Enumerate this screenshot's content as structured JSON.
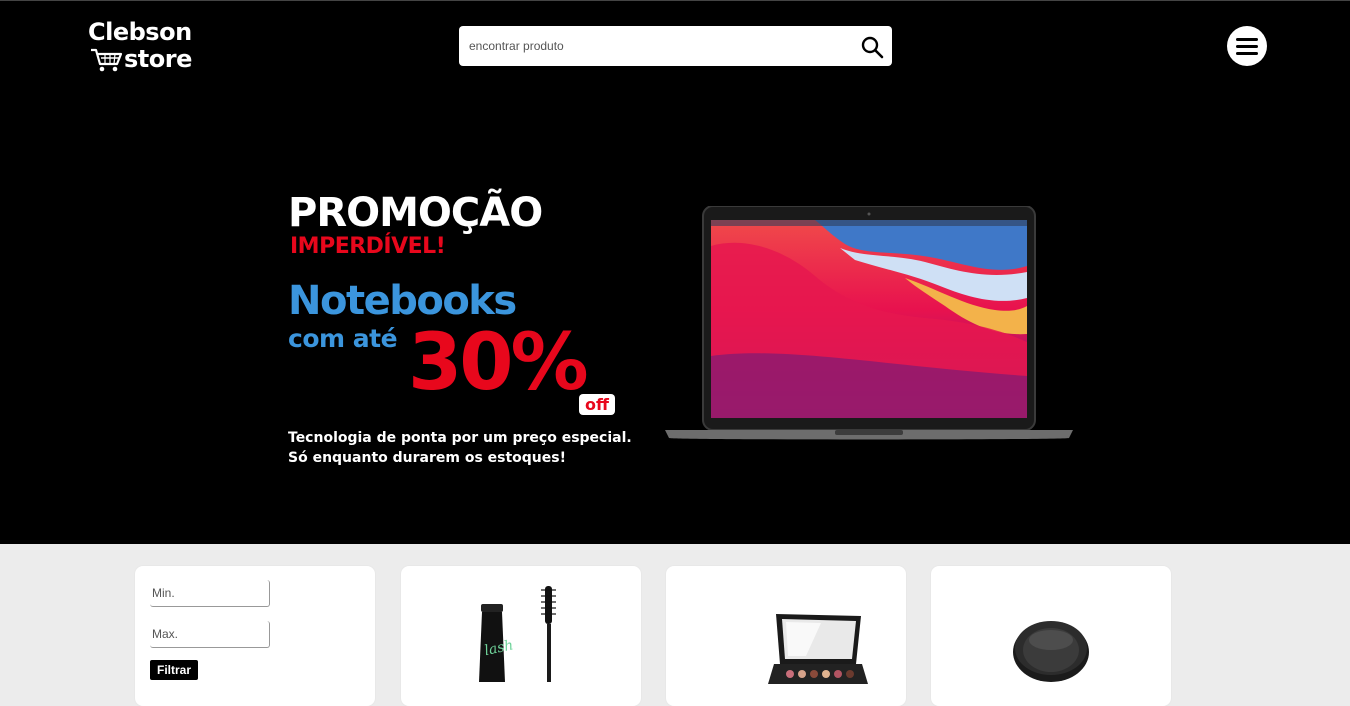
{
  "header": {
    "logo_line1": "Clebson",
    "logo_line2": "store",
    "search_placeholder": "encontrar produto",
    "search_icon": "search-icon",
    "menu_icon": "hamburger-menu-icon"
  },
  "banner": {
    "title": "PROMOÇÃO",
    "subtitle": "IMPERDÍVEL!",
    "product": "Notebooks",
    "prefix": "com até",
    "discount": "30%",
    "off_label": "off",
    "line1": "Tecnologia de ponta por um preço especial.",
    "line2": "Só enquanto durarem os estoques!",
    "colors": {
      "red": "#e8071c",
      "blue": "#3b95dd"
    }
  },
  "filter": {
    "min_placeholder": "Min.",
    "max_placeholder": "Max.",
    "button_label": "Filtrar"
  },
  "products": [
    {
      "image": "mascara-image"
    },
    {
      "image": "eyeshadow-palette-image"
    },
    {
      "image": "compact-powder-image"
    }
  ]
}
